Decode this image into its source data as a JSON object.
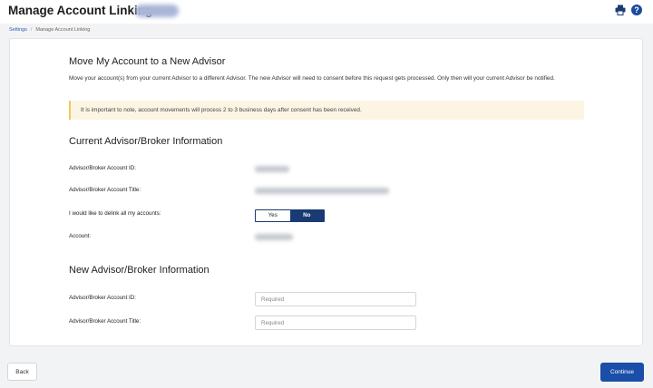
{
  "header": {
    "title": "Manage Account Linking",
    "print_icon": "print-icon",
    "help_icon": "help-icon",
    "help_glyph": "?"
  },
  "breadcrumb": {
    "items": [
      "Settings",
      "Manage Account Linking"
    ],
    "separator": "/"
  },
  "move_section": {
    "title": "Move My Account to a New Advisor",
    "description": "Move your account(s) from your current Advisor to a different Advisor. The new Advisor will need to consent before this request gets processed. Only then will your current Advisor be notified.",
    "notice": "It is important to note, account movements will process 2 to 3 business days after consent has been received."
  },
  "current_advisor": {
    "title": "Current Advisor/Broker Information",
    "account_id_label": "Advisor/Broker Account ID:",
    "account_title_label": "Advisor/Broker Account Title:",
    "delink_label": "I would like to delink all my accounts:",
    "delink_options": [
      "Yes",
      "No"
    ],
    "delink_selected": "No",
    "account_label": "Account:"
  },
  "new_advisor": {
    "title": "New Advisor/Broker Information",
    "account_id_label": "Advisor/Broker Account ID:",
    "account_id_placeholder": "Required",
    "account_id_value": "",
    "account_title_label": "Advisor/Broker Account Title:",
    "account_title_placeholder": "Required",
    "account_title_value": ""
  },
  "footer": {
    "back_label": "Back",
    "continue_label": "Continue"
  },
  "colors": {
    "primary": "#1a4ea8",
    "toggle_active": "#1a3a73",
    "notice_bg": "#fdf5e3",
    "notice_border": "#f0c766",
    "link": "#2a5cb8"
  }
}
